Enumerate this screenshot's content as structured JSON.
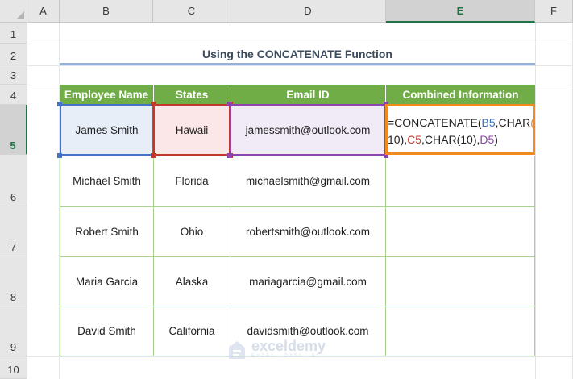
{
  "column_headers": [
    "A",
    "B",
    "C",
    "D",
    "E",
    "F"
  ],
  "row_headers": [
    "1",
    "2",
    "3",
    "4",
    "5",
    "6",
    "7",
    "8",
    "9",
    "10"
  ],
  "title": "Using the CONCATENATE Function",
  "table": {
    "headers": [
      "Employee Name",
      "States",
      "Email ID",
      "Combined Information"
    ],
    "rows": [
      {
        "name": "James Smith",
        "state": "Hawaii",
        "email": "jamessmith@outlook.com"
      },
      {
        "name": "Michael Smith",
        "state": "Florida",
        "email": "michaelsmith@gmail.com"
      },
      {
        "name": "Robert Smith",
        "state": "Ohio",
        "email": "robertsmith@outlook.com"
      },
      {
        "name": "Maria Garcia",
        "state": "Alaska",
        "email": "mariagarcia@gmail.com"
      },
      {
        "name": "David Smith",
        "state": "California",
        "email": "davidsmith@outlook.com"
      }
    ]
  },
  "formula": {
    "p1": "=CONCATENATE(",
    "r1": "B5",
    "p2": ",CHAR",
    "paren_open": "(",
    "p3": "10)",
    "comma1": ",",
    "r2": "C5",
    "p4": ",CHAR(10),",
    "r3": "D5",
    "p5": ")"
  },
  "active_cell": "E5",
  "watermark": {
    "name": "exceldemy",
    "tagline": "EXCEL · DATA · BI"
  },
  "colors": {
    "header_green": "#70ad47",
    "ref_blue": "#3a6fc4",
    "ref_red": "#c0392b",
    "ref_purple": "#8e44ad",
    "active_border": "#f08a1c"
  }
}
